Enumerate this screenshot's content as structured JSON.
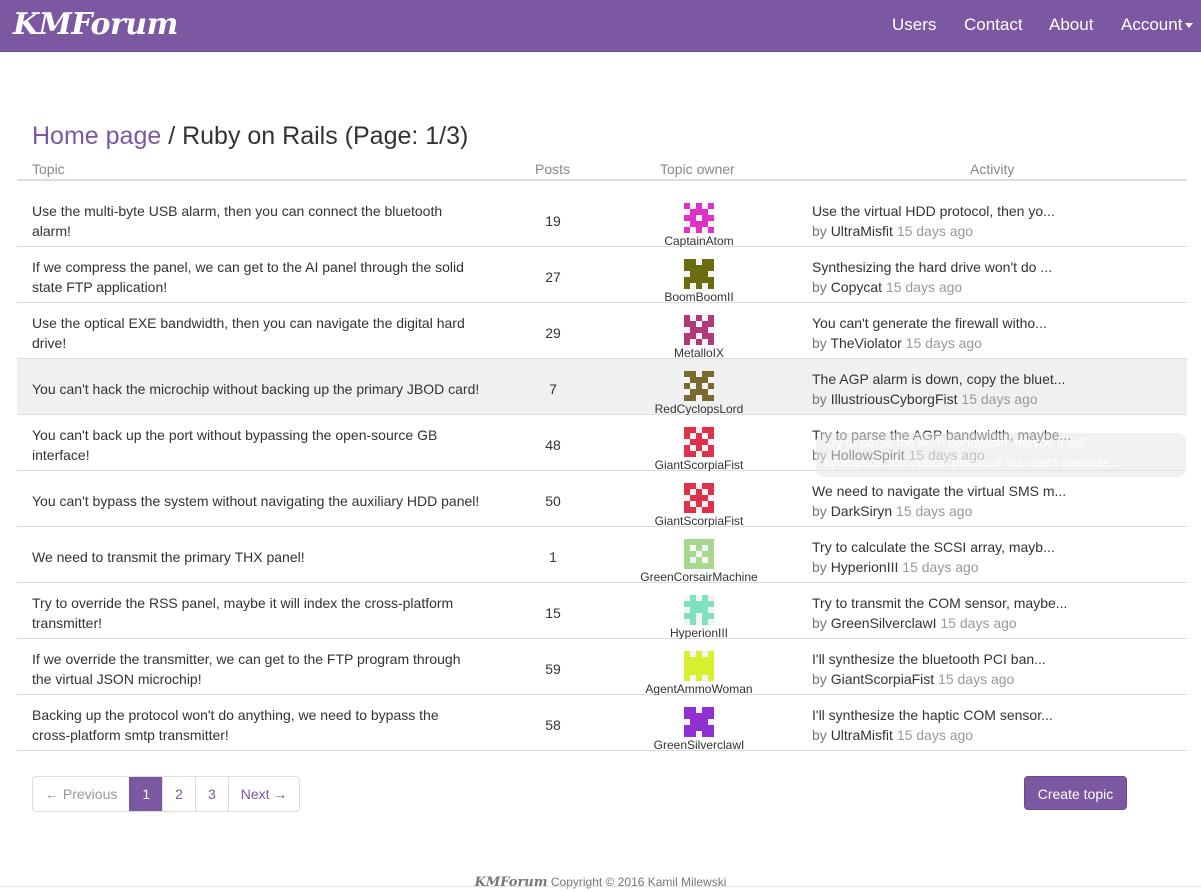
{
  "navbar": {
    "brand": "KMForum",
    "links": [
      {
        "label": "Users"
      },
      {
        "label": "Contact"
      },
      {
        "label": "About"
      },
      {
        "label": "Account"
      }
    ]
  },
  "heading": {
    "breadcrumb": "Home page",
    "separator": " / ",
    "title": "Ruby on Rails (Page: 1/3)"
  },
  "table": {
    "headers": {
      "topic": "Topic",
      "posts": "Posts",
      "owner": "Topic owner",
      "activity": "Activity"
    },
    "rows": [
      {
        "topic_l1": "Use the multi-byte USB alarm, then you can connect the bluetooth",
        "topic_l2": "alarm!",
        "posts": "19",
        "owner": "CaptainAtom",
        "avatar_color": "#e030c8",
        "act_title": "Use the virtual HDD protocol, then yo...",
        "act_by": "by ",
        "act_user": "UltraMisfit",
        "act_ago": "15 days ago"
      },
      {
        "topic_l1": "If we compress the panel, we can get to the AI panel through the solid",
        "topic_l2": "state FTP application!",
        "posts": "27",
        "owner": "BoomBoomII",
        "avatar_color": "#6b6b10",
        "act_title": "Synthesizing the hard drive won't do ...",
        "act_by": "by ",
        "act_user": "Copycat",
        "act_ago": "15 days ago"
      },
      {
        "topic_l1": "Use the optical EXE bandwidth, then you can navigate the digital hard",
        "topic_l2": "drive!",
        "posts": "29",
        "owner": "MetalloIX",
        "avatar_color": "#b03a78",
        "act_title": "You can't generate the firewall witho...",
        "act_by": "by ",
        "act_user": "TheViolator",
        "act_ago": "15 days ago"
      },
      {
        "topic_l1": "You can't hack the microchip without backing up the primary JBOD card!",
        "topic_l2": "",
        "posts": "7",
        "owner": "RedCyclopsLord",
        "avatar_color": "#7a6a30",
        "act_title": "The AGP alarm is down, copy the bluet...",
        "act_by": "by ",
        "act_user": "IllustriousCyborgFist",
        "act_ago": "15 days ago"
      },
      {
        "topic_l1": "You can't back up the port without bypassing the open-source GB",
        "topic_l2": "interface!",
        "posts": "48",
        "owner": "GiantScorpiaFist",
        "avatar_color": "#e0304a",
        "act_title": "Try to parse the AGP bandwidth, maybe...",
        "act_by": "by ",
        "act_user": "HollowSpirit",
        "act_ago": "15 days ago"
      },
      {
        "topic_l1": "You can't bypass the system without navigating the auxiliary HDD panel!",
        "topic_l2": "",
        "posts": "50",
        "owner": "GiantScorpiaFist",
        "avatar_color": "#e0304a",
        "act_title": "We need to navigate the virtual SMS m...",
        "act_by": "by ",
        "act_user": "DarkSiryn",
        "act_ago": "15 days ago"
      },
      {
        "topic_l1": "We need to transmit the primary THX panel!",
        "topic_l2": "",
        "posts": "1",
        "owner": "GreenCorsairMachine",
        "avatar_color": "#a8d890",
        "act_title": "Try to calculate the SCSI array, mayb...",
        "act_by": "by ",
        "act_user": "HyperionIII",
        "act_ago": "15 days ago"
      },
      {
        "topic_l1": "Try to override the RSS panel, maybe it will index the cross-platform",
        "topic_l2": "transmitter!",
        "posts": "15",
        "owner": "HyperionIII",
        "avatar_color": "#80e0c0",
        "act_title": "Try to transmit the COM sensor, maybe...",
        "act_by": "by ",
        "act_user": "GreenSilverclawI",
        "act_ago": "15 days ago"
      },
      {
        "topic_l1": "If we override the transmitter, we can get to the FTP program through",
        "topic_l2": "the virtual JSON microchip!",
        "posts": "59",
        "owner": "AgentAmmoWoman",
        "avatar_color": "#d8f030",
        "act_title": "I'll synthesize the bluetooth PCI ban...",
        "act_by": "by ",
        "act_user": "GiantScorpiaFist",
        "act_ago": "15 days ago"
      },
      {
        "topic_l1": "Backing up the protocol won't do anything, we need to bypass the",
        "topic_l2": "cross-platform smtp transmitter!",
        "posts": "58",
        "owner": "GreenSilverclawI",
        "avatar_color": "#9030d0",
        "act_title": "I'll synthesize the haptic COM sensor...",
        "act_by": "by ",
        "act_user": "UltraMisfit",
        "act_ago": "15 days ago"
      }
    ]
  },
  "tooltip": {
    "line1": "Try to parse the AGP bandwidth, maybe it will",
    "line2": "synthesize the optical protocol! You can't override..."
  },
  "pagination": {
    "prev": "← Previous",
    "pages": [
      "1",
      "2",
      "3"
    ],
    "active": "1",
    "next": "Next →"
  },
  "actions": {
    "create_topic": "Create topic"
  },
  "footer": {
    "brand": "KMForum",
    "text": " Copyright © 2016 Kamil Milewski"
  },
  "colors": {
    "accent": "#7b58a1",
    "row_hover": "#f0f0f0",
    "border": "#dddddd"
  }
}
